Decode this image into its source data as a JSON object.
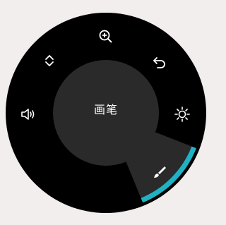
{
  "dial": {
    "center_label": "画笔",
    "tools": [
      {
        "icon": "zoom-in-icon"
      },
      {
        "icon": "undo-icon"
      },
      {
        "icon": "brightness-icon"
      },
      {
        "icon": "brush-icon",
        "selected": true
      },
      {
        "icon": "volume-icon"
      },
      {
        "icon": "scroll-icon"
      }
    ],
    "colors": {
      "background": "#f3eeee",
      "ring": "#000000",
      "center": "#2a2a2a",
      "selected_sector": "#2a2a2a",
      "accent": "#1fb2c4",
      "icon": "#ffffff"
    }
  }
}
